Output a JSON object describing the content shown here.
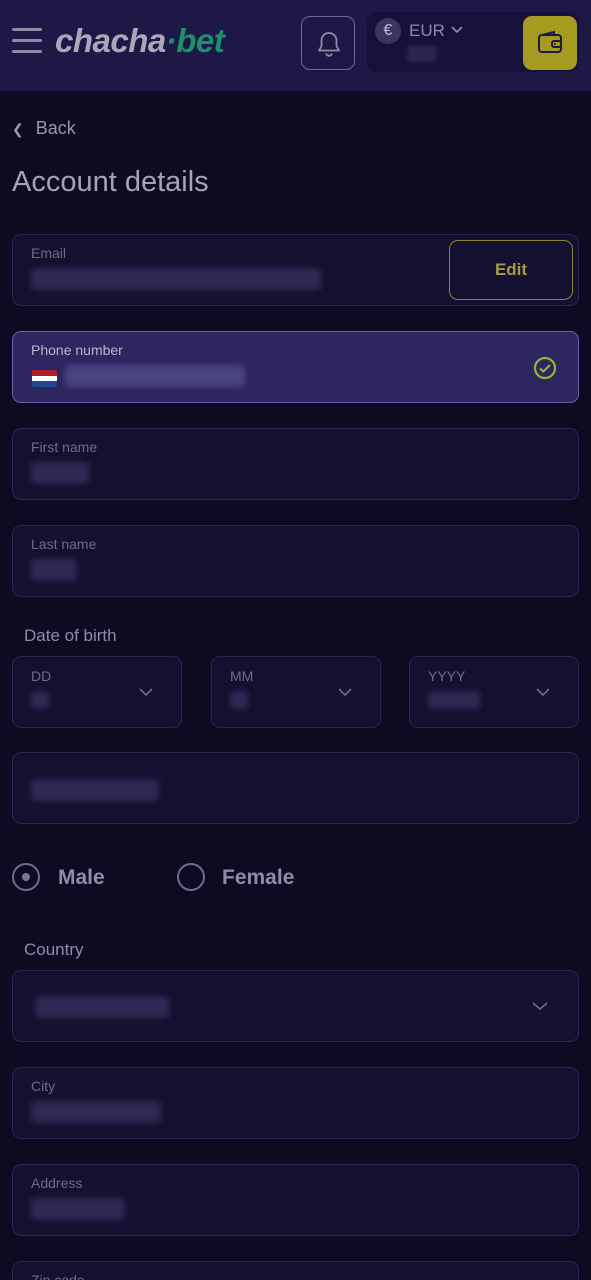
{
  "header": {
    "logo_main": "chacha",
    "logo_sep": "·",
    "logo_accent": "bet",
    "currency_symbol": "€",
    "currency_code": "EUR",
    "menu_icon": "hamburger-menu-icon",
    "notification_icon": "bell-icon",
    "wallet_icon": "wallet-icon"
  },
  "nav": {
    "back_label": "Back"
  },
  "page": {
    "title": "Account details"
  },
  "form": {
    "email": {
      "label": "Email",
      "edit_label": "Edit"
    },
    "phone": {
      "label": "Phone number",
      "verified_icon": "check-circle-icon",
      "flag_icon": "netherlands-flag-icon"
    },
    "first_name": {
      "label": "First name"
    },
    "last_name": {
      "label": "Last name"
    },
    "dob": {
      "label": "Date of birth",
      "day": "DD",
      "month": "MM",
      "year": "YYYY"
    },
    "gender": {
      "male": "Male",
      "female": "Female",
      "selected": "Male"
    },
    "country": {
      "label": "Country"
    },
    "city": {
      "label": "City"
    },
    "address": {
      "label": "Address"
    },
    "zip": {
      "label": "Zip code"
    }
  },
  "colors": {
    "background": "#0d0a22",
    "header": "#1d1846",
    "wallet_button": "#a49b1f",
    "logo_accent": "#1d8f6a",
    "active_field": "#2d2660",
    "verified": "#8fb82a"
  }
}
